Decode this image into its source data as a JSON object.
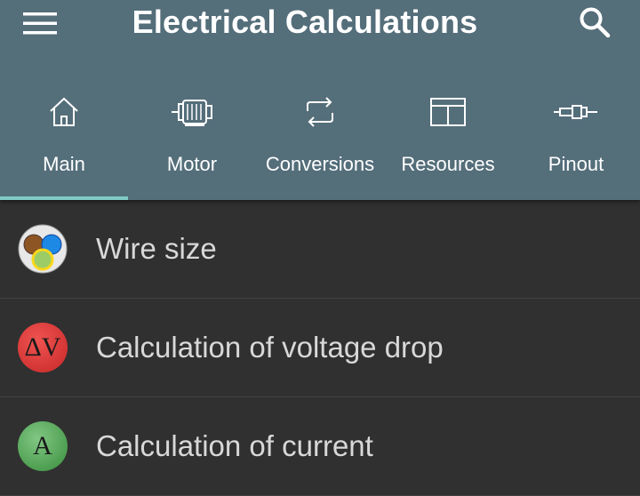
{
  "app": {
    "title": "Electrical Calculations",
    "menu_icon": "hamburger-menu-icon",
    "search_icon": "search-icon"
  },
  "colors": {
    "appbar": "#546e7a",
    "indicator": "#80cbc4",
    "background": "#303030",
    "text": "#d8d8d8"
  },
  "tabs": [
    {
      "label": "Main",
      "icon": "home-icon",
      "selected": true
    },
    {
      "label": "Motor",
      "icon": "motor-icon",
      "selected": false
    },
    {
      "label": "Conversions",
      "icon": "repeat-icon",
      "selected": false
    },
    {
      "label": "Resources",
      "icon": "book-icon",
      "selected": false
    },
    {
      "label": "Pinout",
      "icon": "connector-icon",
      "selected": false
    }
  ],
  "items": [
    {
      "label": "Wire size",
      "icon": "wire-colors-icon"
    },
    {
      "label": "Calculation of voltage drop",
      "icon": "voltage-drop-icon",
      "badge": "ΔV"
    },
    {
      "label": "Calculation of current",
      "icon": "current-icon",
      "badge": "A"
    }
  ]
}
